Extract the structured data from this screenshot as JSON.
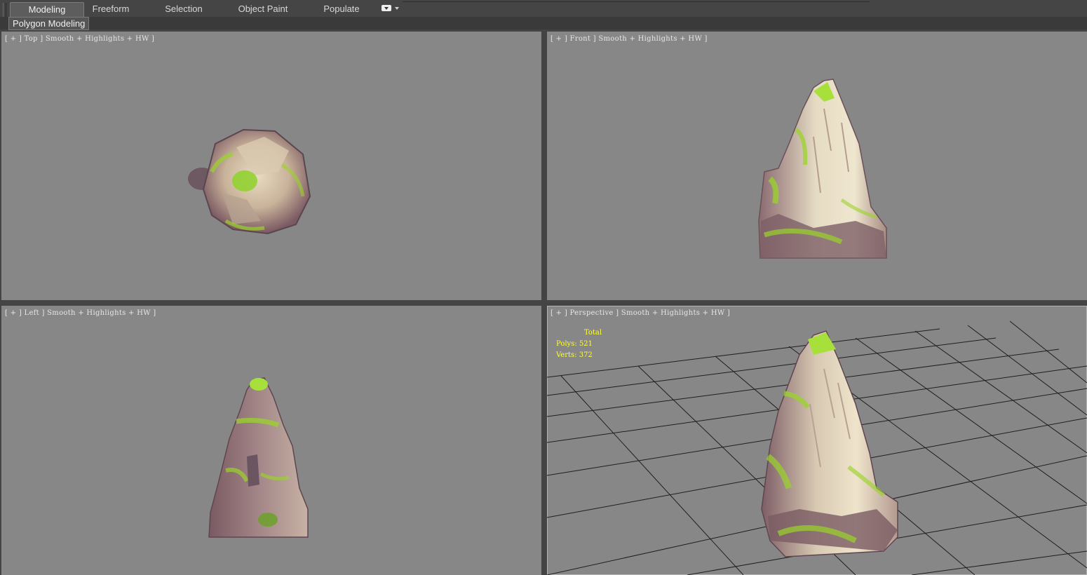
{
  "ribbon": {
    "tabs": [
      {
        "label": "Modeling",
        "active": true
      },
      {
        "label": "Freeform",
        "active": false
      },
      {
        "label": "Selection",
        "active": false
      },
      {
        "label": "Object Paint",
        "active": false
      },
      {
        "label": "Populate",
        "active": false
      }
    ],
    "sub_tab": "Polygon Modeling"
  },
  "viewports": {
    "top": {
      "label": "[ + ] Top ] Smooth + Highlights + HW ]"
    },
    "front": {
      "label": "[ + ] Front ] Smooth + Highlights + HW ]"
    },
    "left": {
      "label": "[ + ] Left ] Smooth + Highlights + HW ]"
    },
    "perspective": {
      "label": "[ + ] Perspective ] Smooth + Highlights + HW ]",
      "stats": {
        "header": "Total",
        "polys": "Polys: 521",
        "verts": "Verts: 372"
      }
    }
  },
  "colors": {
    "viewport_bg": "#878787",
    "ui_bg": "#444444",
    "stats_text": "#ffff33",
    "moss": "#9ad42a",
    "rock_light": "#e6dcc4",
    "rock_dark": "#8a6a6a"
  }
}
